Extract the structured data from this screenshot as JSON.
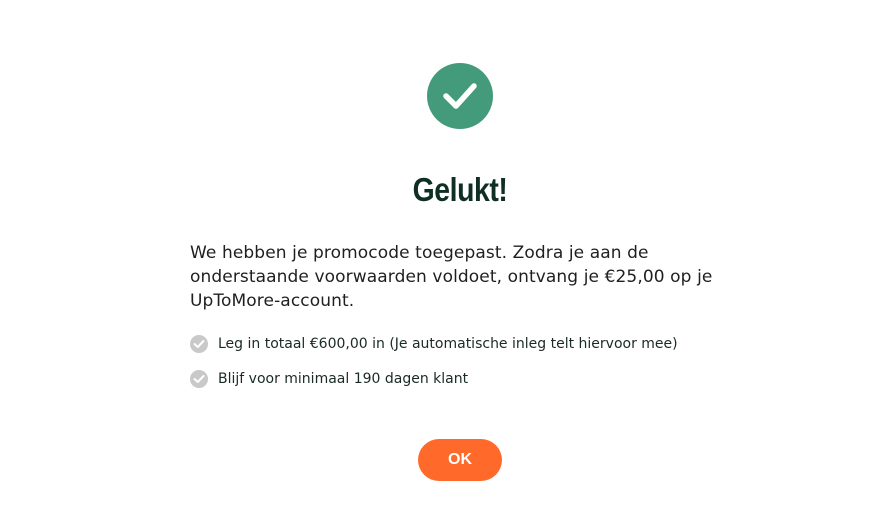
{
  "colors": {
    "accent_green": "#439b7c",
    "accent_orange": "#ff6a2b",
    "check_grey": "#c9c9c9",
    "title_color": "#0f2f24"
  },
  "icons": {
    "success": "check-circle-icon",
    "condition": "check-circle-icon"
  },
  "dialog": {
    "title": "Gelukt!",
    "message_lines": [
      "We hebben je promocode toegepast. Zodra je aan de",
      "onderstaande voorwaarden voldoet, ontvang je €25,00 op je",
      "UpToMore-account."
    ],
    "conditions": [
      {
        "text": "Leg in totaal €600,00 in (Je automatische inleg telt hiervoor mee)"
      },
      {
        "text": "Blijf voor minimaal 190 dagen klant"
      }
    ],
    "ok_label": "OK"
  }
}
